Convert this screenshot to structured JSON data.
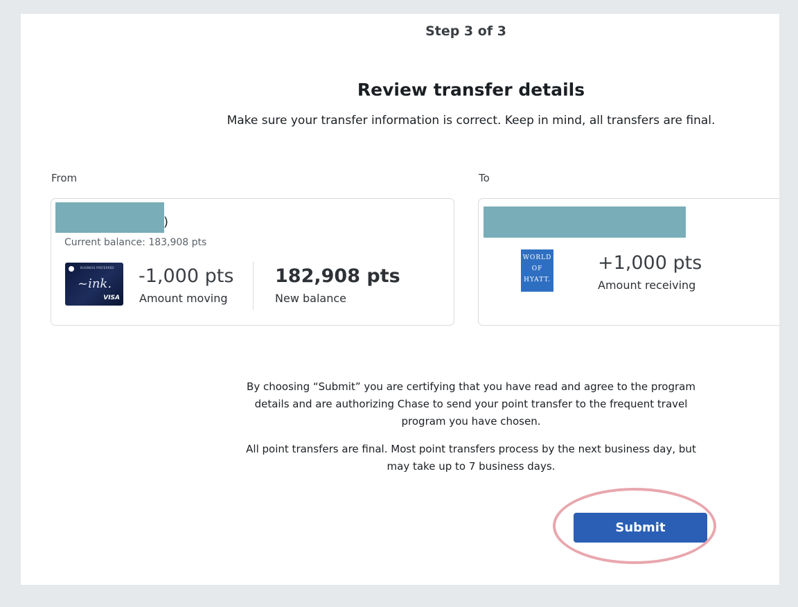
{
  "header": {
    "step": "Step 3 of 3",
    "title": "Review transfer details",
    "subtitle": "Make sure your transfer information is correct. Keep in mind, all transfers are final."
  },
  "from": {
    "label": "From",
    "account_suffix": ")",
    "current_balance": "Current balance: 183,908 pts",
    "card_icon": "chase-ink-business-preferred-card-icon",
    "amount_moving_value": "-1,000 pts",
    "amount_moving_label": "Amount moving",
    "new_balance_value": "182,908 pts",
    "new_balance_label": "New balance"
  },
  "to": {
    "label": "To",
    "logo_lines": [
      "WORLD",
      "OF",
      "HYATT."
    ],
    "amount_receiving_value": "+1,000 pts",
    "amount_receiving_label": "Amount receiving"
  },
  "legal": {
    "paragraph1_line1": "By choosing “Submit” you are certifying that you have read and agree to the program",
    "paragraph1_line2": "details and are authorizing Chase to send your point transfer to the frequent travel",
    "paragraph1_line3": "program you have chosen.",
    "paragraph2_line1": "All point transfers are final. Most point transfers process by the next business day, but",
    "paragraph2_line2": "may take up to 7 business days."
  },
  "actions": {
    "submit_label": "Submit"
  },
  "colors": {
    "primary_button": "#2a5fb5",
    "redaction": "#79adb8",
    "highlight_ring": "#e8a7ad",
    "hyatt_blue": "#2f6fc2"
  }
}
